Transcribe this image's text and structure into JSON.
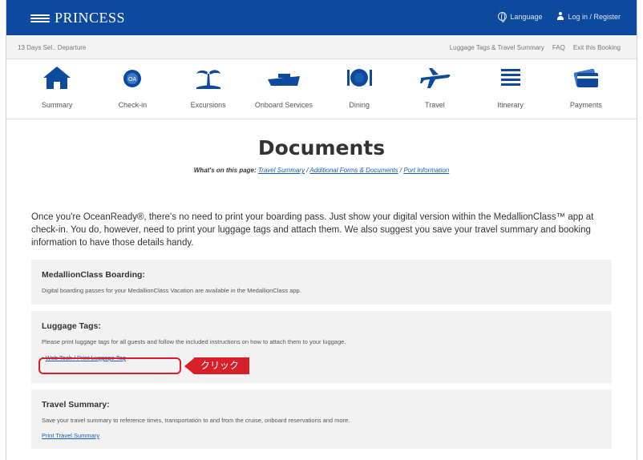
{
  "brand": {
    "name": "PRINCESS"
  },
  "topbar": {
    "language": "Language",
    "login": "Log in / Register"
  },
  "subbar": {
    "cruise": "13 Days Sel.. Departure",
    "links": [
      "Luggage Tags & Travel Summary",
      "FAQ",
      "Exit this Booking"
    ]
  },
  "nav": {
    "items": [
      {
        "label": "Summary",
        "icon": "home-icon"
      },
      {
        "label": "Check-in",
        "icon": "check-in-icon"
      },
      {
        "label": "Excursions",
        "icon": "palm-tree-icon"
      },
      {
        "label": "Onboard Services",
        "icon": "ship-icon"
      },
      {
        "label": "Dining",
        "icon": "dining-icon"
      },
      {
        "label": "Travel",
        "icon": "airplane-icon"
      },
      {
        "label": "Itinerary",
        "icon": "itinerary-icon"
      },
      {
        "label": "Payments",
        "icon": "credit-card-icon"
      }
    ]
  },
  "page": {
    "title": "Documents",
    "on_page_label": "What's on this page:",
    "on_page_links": [
      "Travel Summary",
      "Additional Forms & Documents",
      "Port Information"
    ],
    "intro": "Once you're OceanReady®, there's no need to print your boarding pass. Just show your digital version within the MedallionClass™ app at check-in. You do, however, need to print your luggage tags and attach them. We also suggest you save your travel summary and booking information to have those details handy."
  },
  "sections": {
    "boarding": {
      "title": "MedallionClass Boarding:",
      "text": "Digital boarding passes for your MedallionClass Vacation are available in the MedallionClass app."
    },
    "luggage": {
      "title": "Luggage Tags:",
      "text": "Please print luggage tags for all guests and follow the included instructions on how to attach them to your luggage.",
      "link": "Web Tech / Print Luggage Tag"
    },
    "travel": {
      "title": "Travel Summary:",
      "text": "Save your travel summary to reference times, transportation to and from the cruise, onboard reservations and more.",
      "link": "Print Travel Summary"
    }
  },
  "annotation": {
    "callout_text": "クリック"
  },
  "colors": {
    "header": "#0d4a9e",
    "icon": "#0d4a9e",
    "link": "#1a5fb4",
    "callout": "#d8202a",
    "panel": "#f2f2f2"
  }
}
